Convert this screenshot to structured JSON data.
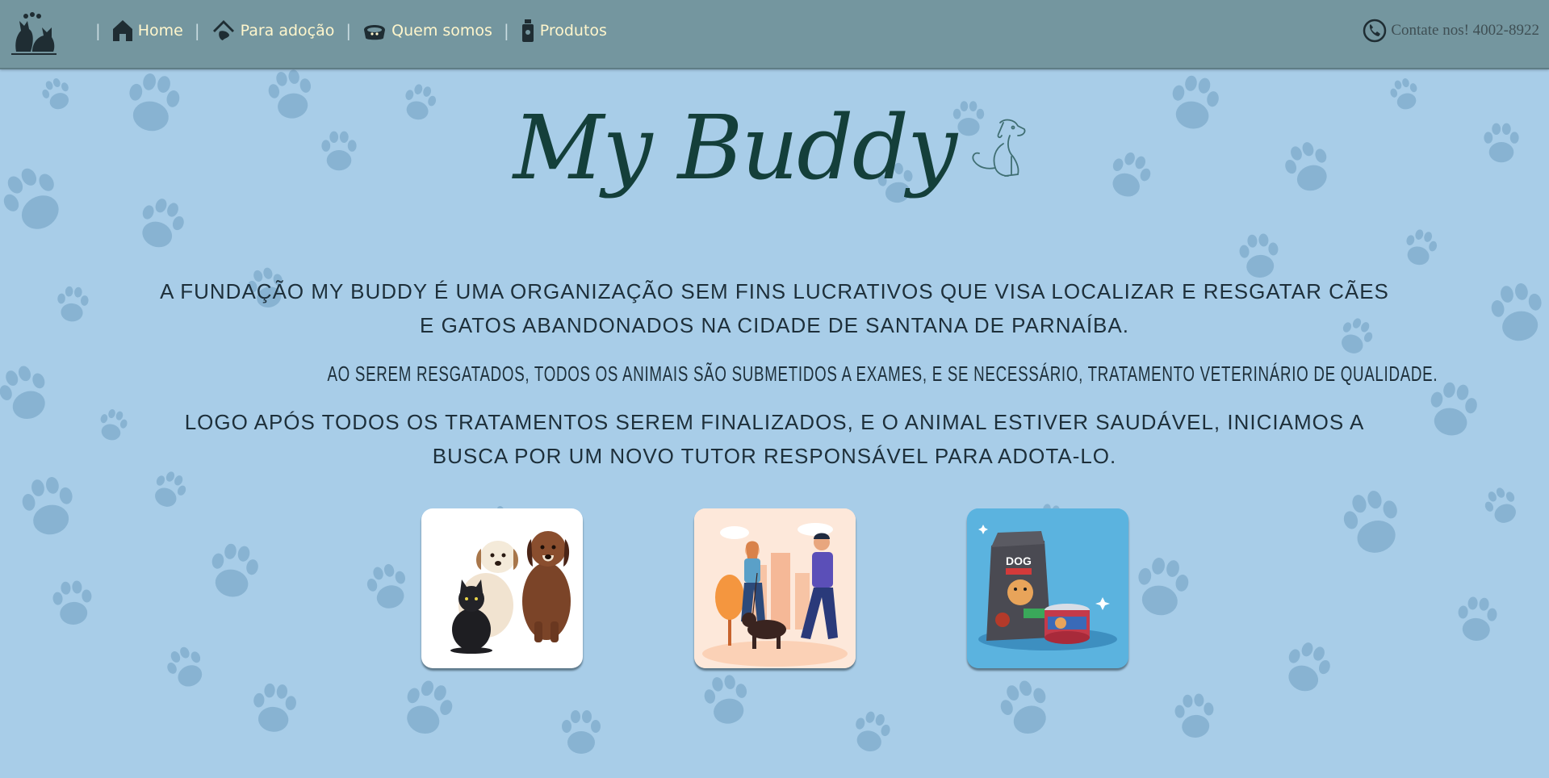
{
  "nav": {
    "logo_icon": "cat-dog-logo-icon",
    "items": [
      {
        "label": "Home",
        "icon": "house-icon"
      },
      {
        "label": "Para adoção",
        "icon": "adoption-house-icon"
      },
      {
        "label": "Quem somos",
        "icon": "pet-bowl-icon"
      },
      {
        "label": "Produtos",
        "icon": "bottle-icon"
      }
    ],
    "separator": "|",
    "contact": {
      "label": "Contate nos! 4002-8922",
      "icon": "phone-icon"
    }
  },
  "brand": {
    "title": "My Buddy",
    "icon": "dog-outline-icon"
  },
  "about": {
    "p1": "A fundação My Buddy é uma organização sem fins lucrativos que visa localizar e resgatar cães e gatos abandonados na cidade de Santana de Parnaíba.",
    "p2": "Ao serem resgatados, todos os animais são submetidos a exames, e se necessário, tratamento veterinário de qualidade.",
    "p3": "Logo após todos os tratamentos serem finalizados, e o animal estiver saudável, iniciamos a busca por um novo tutor responsável para adota-lo."
  },
  "cards": [
    {
      "name": "adoption-card",
      "image": "dogs-and-cat-illustration"
    },
    {
      "name": "about-card",
      "image": "couple-walking-dog-illustration"
    },
    {
      "name": "products-card",
      "image": "dog-food-bag-illustration"
    }
  ],
  "colors": {
    "navbar": "#74969f",
    "background": "#a8cde8",
    "nav_text": "#fff6cc",
    "title": "#143f3a",
    "paw": "#6e9ec0"
  }
}
